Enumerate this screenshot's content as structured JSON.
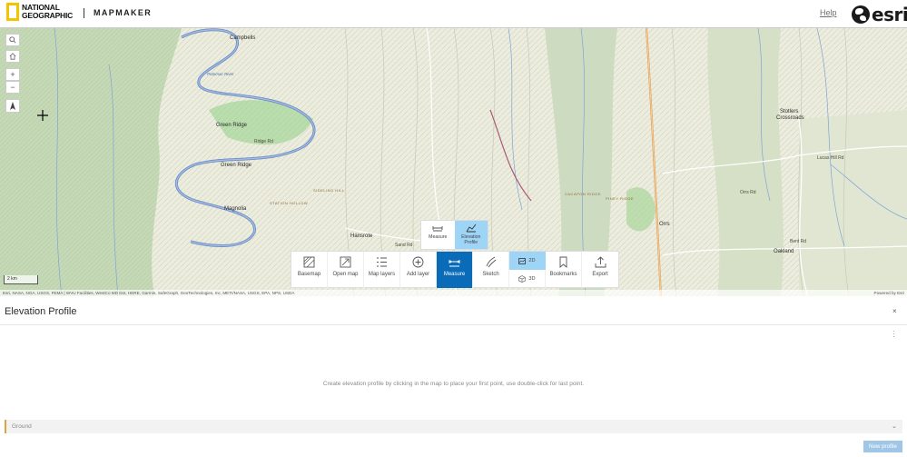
{
  "header": {
    "brand_line1": "NATIONAL",
    "brand_line2": "GEOGRAPHIC",
    "app_name": "MAPMAKER",
    "help_label": "Help",
    "esri_label": "esri"
  },
  "map": {
    "scale_label": "2 km",
    "attribution": "Esri, NASA, NGA, USGS, FEMA | WVU Facilities, WestCo MD Dot, HERE, Garmin, SafeGraph, GeoTechnologies, Inc, METI/NASA, USGS, EPA, NPS, USDA",
    "powered_by": "Powered by Esri",
    "labels": {
      "campbells": "Campbells",
      "green_ridge_1": "Green Ridge",
      "green_ridge_2": "Green Ridge",
      "magnolia": "Magnolia",
      "hansrote": "Hansrote",
      "orrs": "Orrs",
      "oakland": "Oakland",
      "stotlers": "Stotlers",
      "crossroads": "Crossroads",
      "potomac": "Potomac River",
      "piney_ridge": "PINEY RIDGE",
      "cacapon": "CACAPON RIDGE",
      "sideling": "SIDELING HILL",
      "station": "STATION HOLLOW",
      "ridge_rd": "Ridge Rd",
      "rd1": "Orrs Rd",
      "rd2": "Lucas Hill Rd",
      "rd3": "Sand Rd",
      "rd4": "Bent Rd"
    }
  },
  "map_controls": {
    "search": "search-icon",
    "home": "home-icon",
    "zoom_in": "+",
    "zoom_out": "−",
    "compass": "compass-icon"
  },
  "measure_popup": {
    "measure_label": "Measure",
    "elevation_label_1": "Elevation",
    "elevation_label_2": "Profile"
  },
  "toolbar": {
    "items": [
      {
        "label": "Basemap",
        "icon": "basemap-icon"
      },
      {
        "label": "Open map",
        "icon": "open-map-icon"
      },
      {
        "label": "Map layers",
        "icon": "layers-icon"
      },
      {
        "label": "Add layer",
        "icon": "add-icon"
      },
      {
        "label": "Measure",
        "icon": "measure-icon",
        "active": true
      },
      {
        "label": "Sketch",
        "icon": "sketch-icon"
      },
      {
        "label": "Bookmarks",
        "icon": "bookmark-icon"
      },
      {
        "label": "Export",
        "icon": "export-icon"
      }
    ],
    "dim_2d": "2D",
    "dim_3d": "3D"
  },
  "panel": {
    "title": "Elevation Profile",
    "close": "×",
    "hint": "Create elevation profile by clicking in the map to place your first point, use double-click for last point.",
    "ground_label": "Ground",
    "new_profile_label": "New profile"
  },
  "colors": {
    "accent": "#0a6bb8",
    "accent_light": "#9ed5f7",
    "ng_yellow": "#f5c400",
    "ground_accent": "#e0a341",
    "disabled_button": "#9fc6e6"
  }
}
